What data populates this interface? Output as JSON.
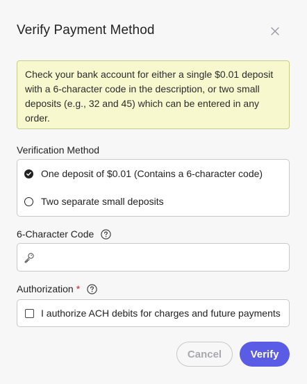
{
  "dialog": {
    "title": "Verify Payment Method",
    "close_icon": "close-icon"
  },
  "notice": {
    "text": "Check your bank account for either a single $0.01 deposit with a 6-character code in the description, or two small deposits (e.g., 32 and 45) which can be entered in any order."
  },
  "verification_method": {
    "label": "Verification Method",
    "options": [
      {
        "label": "One deposit of $0.01 (Contains a 6-character code)",
        "selected": true
      },
      {
        "label": "Two separate small deposits",
        "selected": false
      }
    ]
  },
  "code_field": {
    "label": "6-Character Code",
    "value": "",
    "placeholder": "",
    "icon": "key-icon",
    "help_icon": "help-icon"
  },
  "authorization": {
    "label": "Authorization",
    "required_marker": "*",
    "help_icon": "help-icon",
    "checkbox_label": "I authorize ACH debits for charges and future payments",
    "checked": false
  },
  "buttons": {
    "cancel_label": "Cancel",
    "verify_label": "Verify"
  },
  "colors": {
    "accent": "#5b5ce6",
    "notice_bg": "#f8f8cf",
    "notice_border": "#c9cb88",
    "required": "#d8212c"
  }
}
